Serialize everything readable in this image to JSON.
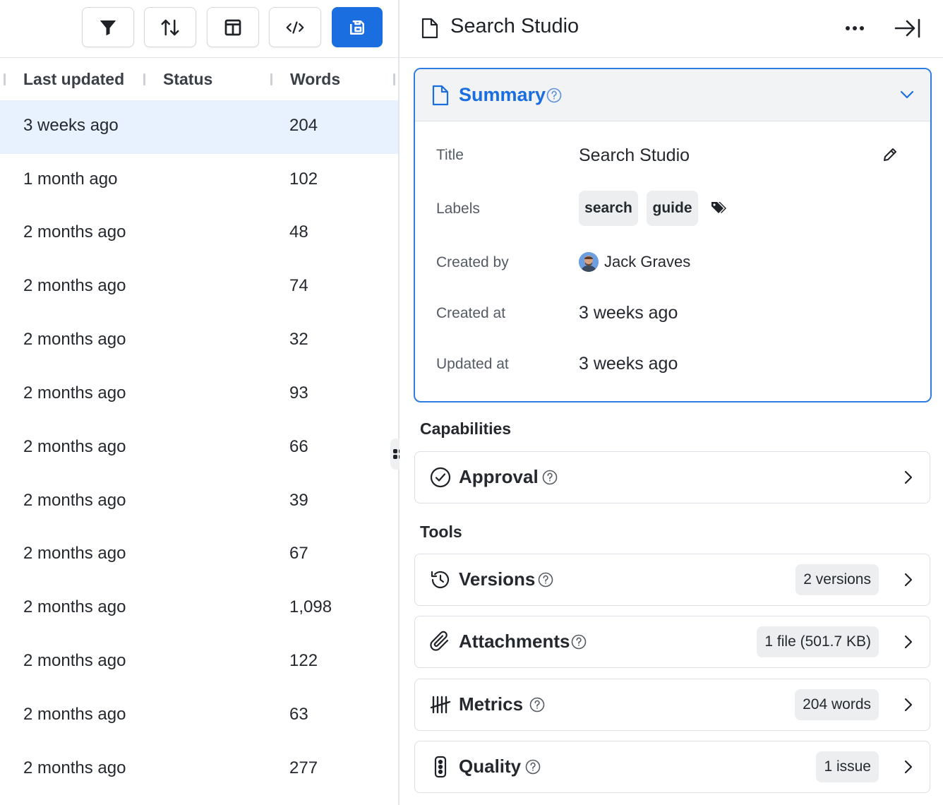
{
  "table": {
    "columns": [
      "Last updated",
      "Status",
      "Words"
    ],
    "rows": [
      {
        "last_updated": "3 weeks ago",
        "status": "",
        "words": "204"
      },
      {
        "last_updated": "1 month ago",
        "status": "",
        "words": "102"
      },
      {
        "last_updated": "2 months ago",
        "status": "",
        "words": "48"
      },
      {
        "last_updated": "2 months ago",
        "status": "",
        "words": "74"
      },
      {
        "last_updated": "2 months ago",
        "status": "",
        "words": "32"
      },
      {
        "last_updated": "2 months ago",
        "status": "",
        "words": "93"
      },
      {
        "last_updated": "2 months ago",
        "status": "",
        "words": "66"
      },
      {
        "last_updated": "2 months ago",
        "status": "",
        "words": "39"
      },
      {
        "last_updated": "2 months ago",
        "status": "",
        "words": "67"
      },
      {
        "last_updated": "2 months ago",
        "status": "",
        "words": "1,098"
      },
      {
        "last_updated": "2 months ago",
        "status": "",
        "words": "122"
      },
      {
        "last_updated": "2 months ago",
        "status": "",
        "words": "63"
      },
      {
        "last_updated": "2 months ago",
        "status": "",
        "words": "277"
      }
    ]
  },
  "toolbar": {
    "icons": [
      "filter-icon",
      "sort-icon",
      "columns-icon",
      "code-icon",
      "save-icon"
    ],
    "accent": "#1a6ee0"
  },
  "panel": {
    "title": "Search Studio",
    "summary": {
      "heading": "Summary",
      "title_label": "Title",
      "title_value": "Search Studio",
      "labels_label": "Labels",
      "labels": [
        "search",
        "guide"
      ],
      "created_by_label": "Created by",
      "created_by_value": "Jack Graves",
      "created_at_label": "Created at",
      "created_at_value": "3 weeks ago",
      "updated_at_label": "Updated at",
      "updated_at_value": "3 weeks ago"
    },
    "capabilities_heading": "Capabilities",
    "capabilities": [
      {
        "title": "Approval",
        "icon": "check-circle-icon"
      }
    ],
    "tools_heading": "Tools",
    "tools": [
      {
        "title": "Versions",
        "badge": "2 versions",
        "icon": "history-icon"
      },
      {
        "title": "Attachments",
        "badge": "1 file (501.7 KB)",
        "icon": "paperclip-icon"
      },
      {
        "title": "Metrics",
        "badge": "204 words",
        "icon": "tally-icon"
      },
      {
        "title": "Quality",
        "badge": "1 issue",
        "icon": "traffic-light-icon"
      }
    ]
  }
}
